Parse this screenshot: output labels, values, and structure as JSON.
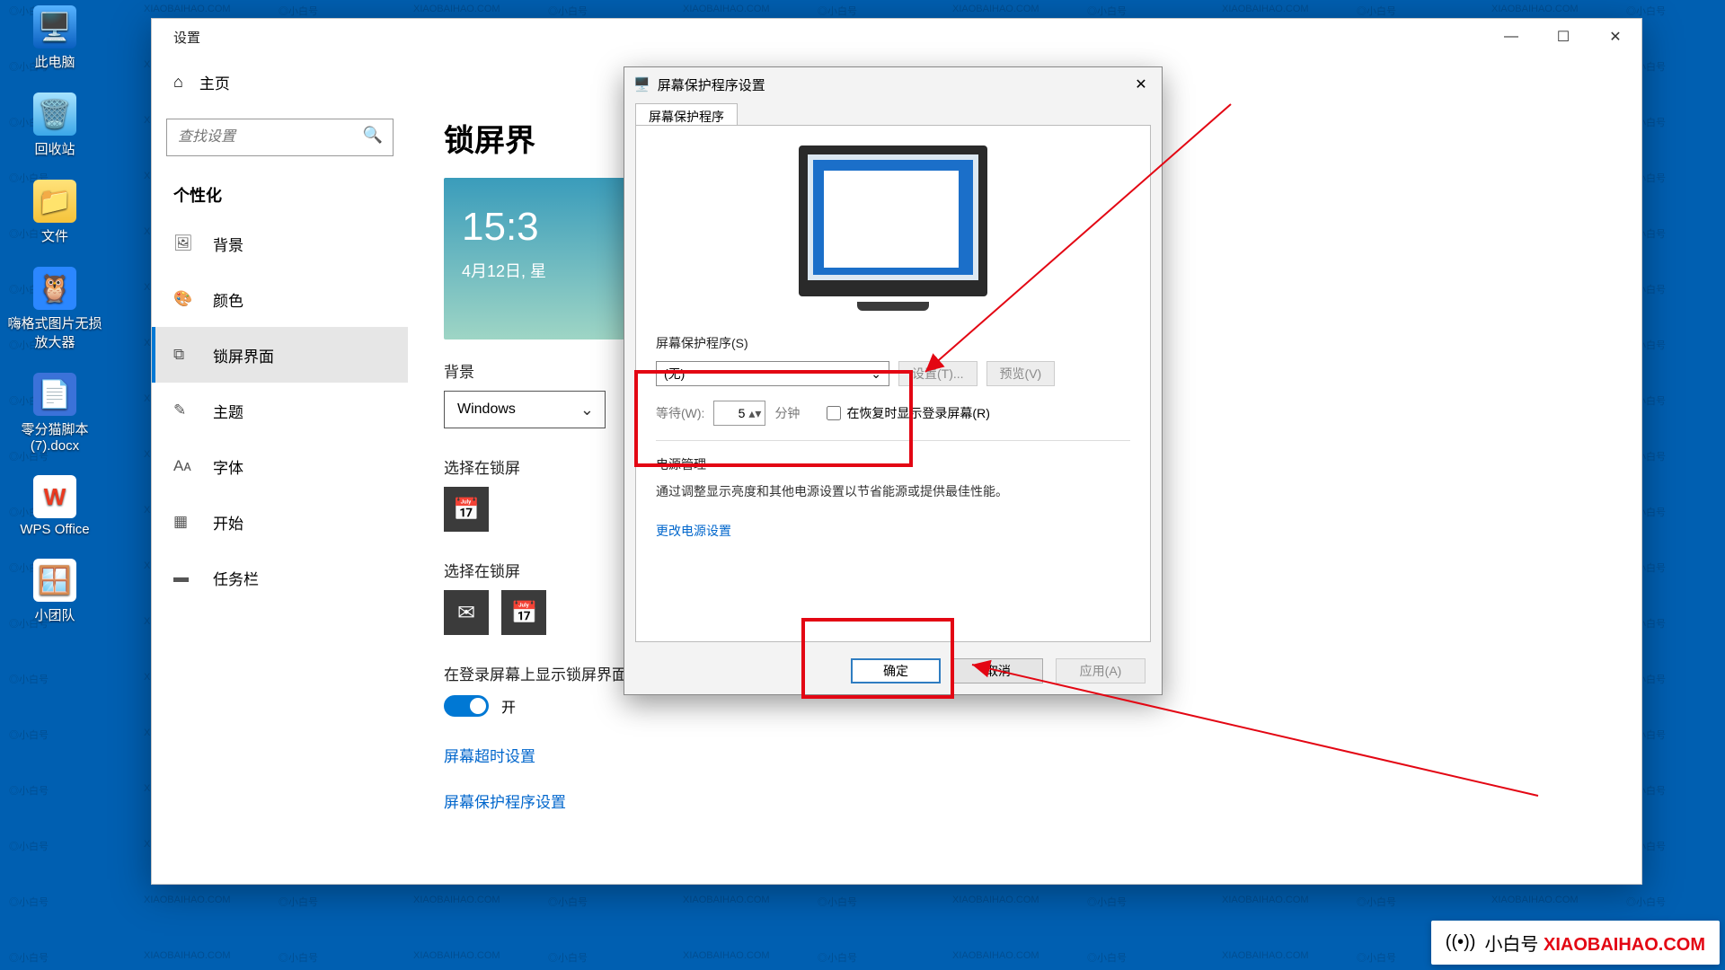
{
  "desktop": {
    "icons": [
      {
        "label": "此电脑"
      },
      {
        "label": "回收站"
      },
      {
        "label": "文件"
      },
      {
        "label": "嗨格式图片无损放大器"
      },
      {
        "label": "零分猫脚本(7).docx"
      },
      {
        "label": "WPS Office"
      },
      {
        "label": "小团队"
      }
    ]
  },
  "settings": {
    "window_title": "设置",
    "home": "主页",
    "search_placeholder": "查找设置",
    "category": "个性化",
    "nav": [
      {
        "label": "背景"
      },
      {
        "label": "颜色"
      },
      {
        "label": "锁屏界面"
      },
      {
        "label": "主题"
      },
      {
        "label": "字体"
      },
      {
        "label": "开始"
      },
      {
        "label": "任务栏"
      }
    ],
    "page_title": "锁屏界",
    "lock_time": "15:3",
    "lock_date": "4月12日, 星",
    "bg_label": "背景",
    "bg_value": "Windows",
    "choose_app_label": "选择在锁屏",
    "choose_quick_label": "选择在锁屏",
    "login_bg_label": "在登录屏幕上显示锁屏界面背景图片",
    "toggle_on": "开",
    "link_timeout": "屏幕超时设置",
    "link_saver": "屏幕保护程序设置"
  },
  "screensaver": {
    "title": "屏幕保护程序设置",
    "tab": "屏幕保护程序",
    "group_label": "屏幕保护程序(S)",
    "select_value": "(无)",
    "btn_settings": "设置(T)...",
    "btn_preview": "预览(V)",
    "wait_label": "等待(W):",
    "wait_value": "5",
    "wait_unit": "分钟",
    "resume_checkbox": "在恢复时显示登录屏幕(R)",
    "power_group": "电源管理",
    "power_desc": "通过调整显示亮度和其他电源设置以节省能源或提供最佳性能。",
    "power_link": "更改电源设置",
    "btn_ok": "确定",
    "btn_cancel": "取消",
    "btn_apply": "应用(A)"
  },
  "branding": {
    "name": "小白号",
    "domain": "XIAOBAIHAO.COM"
  }
}
